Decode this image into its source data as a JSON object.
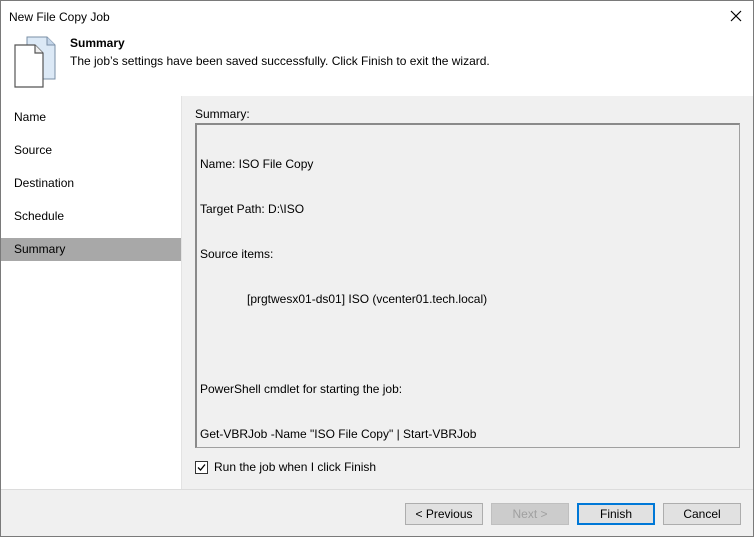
{
  "window": {
    "title": "New File Copy Job",
    "close_icon": "close-icon"
  },
  "header": {
    "icon": "file-copy-icon",
    "title": "Summary",
    "description": "The job’s settings have been saved successfully. Click Finish to exit the wizard."
  },
  "sidebar": {
    "items": [
      {
        "label": "Name"
      },
      {
        "label": "Source"
      },
      {
        "label": "Destination"
      },
      {
        "label": "Schedule"
      },
      {
        "label": "Summary",
        "active": true
      }
    ]
  },
  "summary": {
    "label": "Summary:",
    "lines": [
      "Name: ISO File Copy",
      "Target Path: D:\\ISO",
      "Source items:",
      "[prgtwesx01-ds01] ISO (vcenter01.tech.local)",
      "",
      "PowerShell cmdlet for starting the job:",
      "Get-VBRJob -Name \"ISO File Copy\" | Start-VBRJob"
    ]
  },
  "run_job": {
    "label": "Run the job when I click Finish",
    "checked": true
  },
  "buttons": {
    "previous": "< Previous",
    "next": "Next >",
    "finish": "Finish",
    "cancel": "Cancel"
  },
  "colors": {
    "active_nav": "#a8a8a8",
    "content_bg": "#f0f0f0",
    "default_button_border": "#0078d7"
  }
}
